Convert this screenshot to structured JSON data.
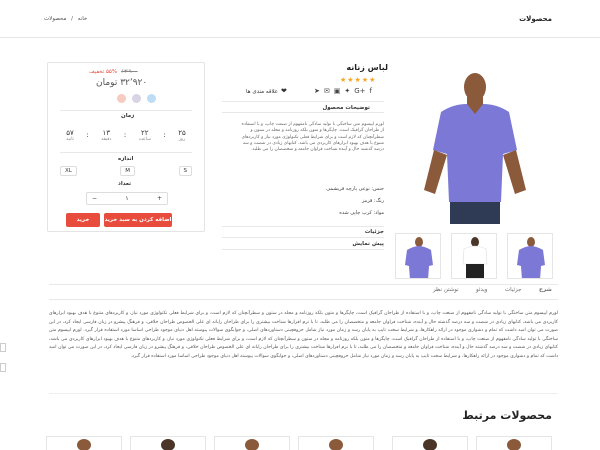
{
  "header": {
    "title": "محصولات",
    "breadcrumb": {
      "home": "خانه",
      "sep": "/",
      "current": "محصولات"
    }
  },
  "product": {
    "title": "لباس زنانه",
    "wishlist": "علاقه مندی ها",
    "description_title": "توضیحات محصول",
    "description": "لورم ایپسوم متن ساختگی با تولید سادگی نامفهوم از صنعت چاپ، و با استفاده از طراحان گرافیک است. چاپگرها و متون بلکه روزنامه و مجله در ستون و سطرآنچنان که لازم است و برای شرایط فعلی تکنولوژی مورد نیاز و کاربردهای متنوع با هدف بهبود ابزارهای کاربردی می باشد. کتابهای زیادی در شصت و سه درصد گذشته حال و آینده شناخت فراوان جامعه و متخصصان را می طلبد.",
    "attributes": {
      "material_label": "جنس:",
      "material": "نوعی پارچه فریشمی",
      "color_label": "رنگ:",
      "color": "قرمز",
      "fabric_label": "مواد:",
      "fabric": "کرپ چاپی شده"
    },
    "sections": {
      "details": "جزئیات",
      "send_review": "پیش نمایش"
    }
  },
  "buy_box": {
    "old_price": "۶۳٬۹۰۰",
    "discount": "۵۵% تخفیف",
    "price": "۳۲٬۹۲۰ تومان",
    "time_label": "زمان",
    "timer": [
      {
        "value": "۲۵",
        "unit": "روز"
      },
      {
        "value": "۲۲",
        "unit": "ساعت"
      },
      {
        "value": "۱۳",
        "unit": "دقیقه"
      },
      {
        "value": "۵۷",
        "unit": "ثانیه"
      }
    ],
    "size_label": "اندازه",
    "sizes": [
      "S",
      "M",
      "XL"
    ],
    "qty_label": "تعداد",
    "qty_value": "۱",
    "add_to_cart": "اضافه کردن به سبد خرید",
    "buy_now": "خرید"
  },
  "tabs": [
    "شرح",
    "جزئیات",
    "ویدئو",
    "نوشتن نظر"
  ],
  "long_text": "لورم ایپسوم متن ساختگی با تولید سادگی نامفهوم از صنعت چاپ، و با استفاده از طراحان گرافیک است، چاپگرها و متون بلکه روزنامه و مجله در ستون و سطرآنچنان که لازم است، و برای شرایط فعلی تکنولوژی مورد نیاز، و کاربردهای متنوع با هدف بهبود ابزارهای کاربردی می باشد، کتابهای زیادی در شصت و سه درصد گذشته حال و آینده، شناخت فراوان جامعه و متخصصان را می طلبد، تا با نرم افزارها شناخت بیشتری را برای طراحان رایانه ای علی الخصوص طراحان خلاقی، و فرهنگ پیشرو در زبان فارسی ایجاد کرد، در این صورت می توان امید داشت که تمام و دشواری موجود در ارائه راهکارها، و شرایط سخت تایپ به پایان رسد و زمان مورد نیاز شامل حروفچینی دستاوردهای اصلی، و جوابگوی سوالات پیوسته اهل دنیای موجود طراحی اساسا مورد استفاده قرار گیرد. لورم ایپسوم متن ساختگی با تولید سادگی نامفهوم از صنعت چاپ، و با استفاده از طراحان گرافیک است، چاپگرها و متون بلکه روزنامه و مجله در ستون و سطرآنچنان که لازم است، و برای شرایط فعلی تکنولوژی مورد نیاز، و کاربردهای متنوع با هدف بهبود ابزارهای کاربردی می باشد، کتابهای زیادی در شصت و سه درصد گذشته حال و آینده، شناخت فراوان جامعه و متخصصان را می طلبد، تا با نرم افزارها شناخت بیشتری را برای طراحان رایانه ای علی الخصوص طراحان خلاقی، و فرهنگ پیشرو در زبان فارسی ایجاد کرد، در این صورت می توان امید داشت که تمام و دشواری موجود در ارائه راهکارها، و شرایط سخت تایپ به پایان رسد و زمان مورد نیاز شامل حروفچینی دستاوردهای اصلی، و جوابگوی سوالات پیوسته اهل دنیای موجود طراحی اساسا مورد استفاده قرار گیرد.",
  "related": {
    "title": "محصولات مرتبط"
  },
  "colors": {
    "accent": "#e74c3c",
    "shirt": "#7b78d6",
    "swatch_peach": "#f6cbc2",
    "swatch_lavender": "#d9d3e6",
    "swatch_blue": "#bfdcf5"
  },
  "icons": [
    "heart-icon",
    "facebook-icon",
    "google-plus-icon",
    "twitter-icon",
    "instagram-icon",
    "email-icon",
    "share-icon"
  ]
}
